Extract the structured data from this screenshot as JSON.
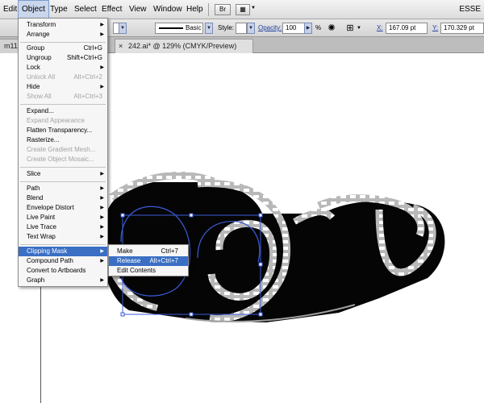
{
  "menubar": {
    "items": [
      "Edit",
      "Object",
      "Type",
      "Select",
      "Effect",
      "View",
      "Window",
      "Help"
    ],
    "bridge_label": "Br",
    "workspace": "ESSE"
  },
  "control": {
    "stroke_style": "Basic",
    "style_label": "Style:",
    "opacity_label": "Opacity:",
    "opacity_value": "100",
    "percent": "%",
    "x_label": "X:",
    "x_value": "167.09 pt",
    "y_label": "Y:",
    "y_value": "170.329 pt"
  },
  "tabs": {
    "partial": "m11.",
    "active_close": "×",
    "active": "242.ai* @ 129% (CMYK/Preview)"
  },
  "object_menu": {
    "transform": "Transform",
    "arrange": "Arrange",
    "group": "Group",
    "group_sc": "Ctrl+G",
    "ungroup": "Ungroup",
    "ungroup_sc": "Shift+Ctrl+G",
    "lock": "Lock",
    "unlock_all": "Unlock All",
    "unlock_all_sc": "Alt+Ctrl+2",
    "hide": "Hide",
    "show_all": "Show All",
    "show_all_sc": "Alt+Ctrl+3",
    "expand": "Expand...",
    "expand_appearance": "Expand Appearance",
    "flatten": "Flatten Transparency...",
    "rasterize": "Rasterize...",
    "gradient_mesh": "Create Gradient Mesh...",
    "object_mosaic": "Create Object Mosaic...",
    "slice": "Slice",
    "path": "Path",
    "blend": "Blend",
    "envelope": "Envelope Distort",
    "live_paint": "Live Paint",
    "live_trace": "Live Trace",
    "text_wrap": "Text Wrap",
    "clipping_mask": "Clipping Mask",
    "compound_path": "Compound Path",
    "convert_artboards": "Convert to Artboards",
    "graph": "Graph"
  },
  "clip_menu": {
    "make": "Make",
    "make_sc": "Ctrl+7",
    "release": "Release",
    "release_sc": "Alt+Ctrl+7",
    "edit_contents": "Edit Contents"
  },
  "colors": {
    "highlight": "#3a6fc4",
    "selection": "#3b5bd9",
    "film": "#050505",
    "film_edge": "#b8b8b8"
  }
}
